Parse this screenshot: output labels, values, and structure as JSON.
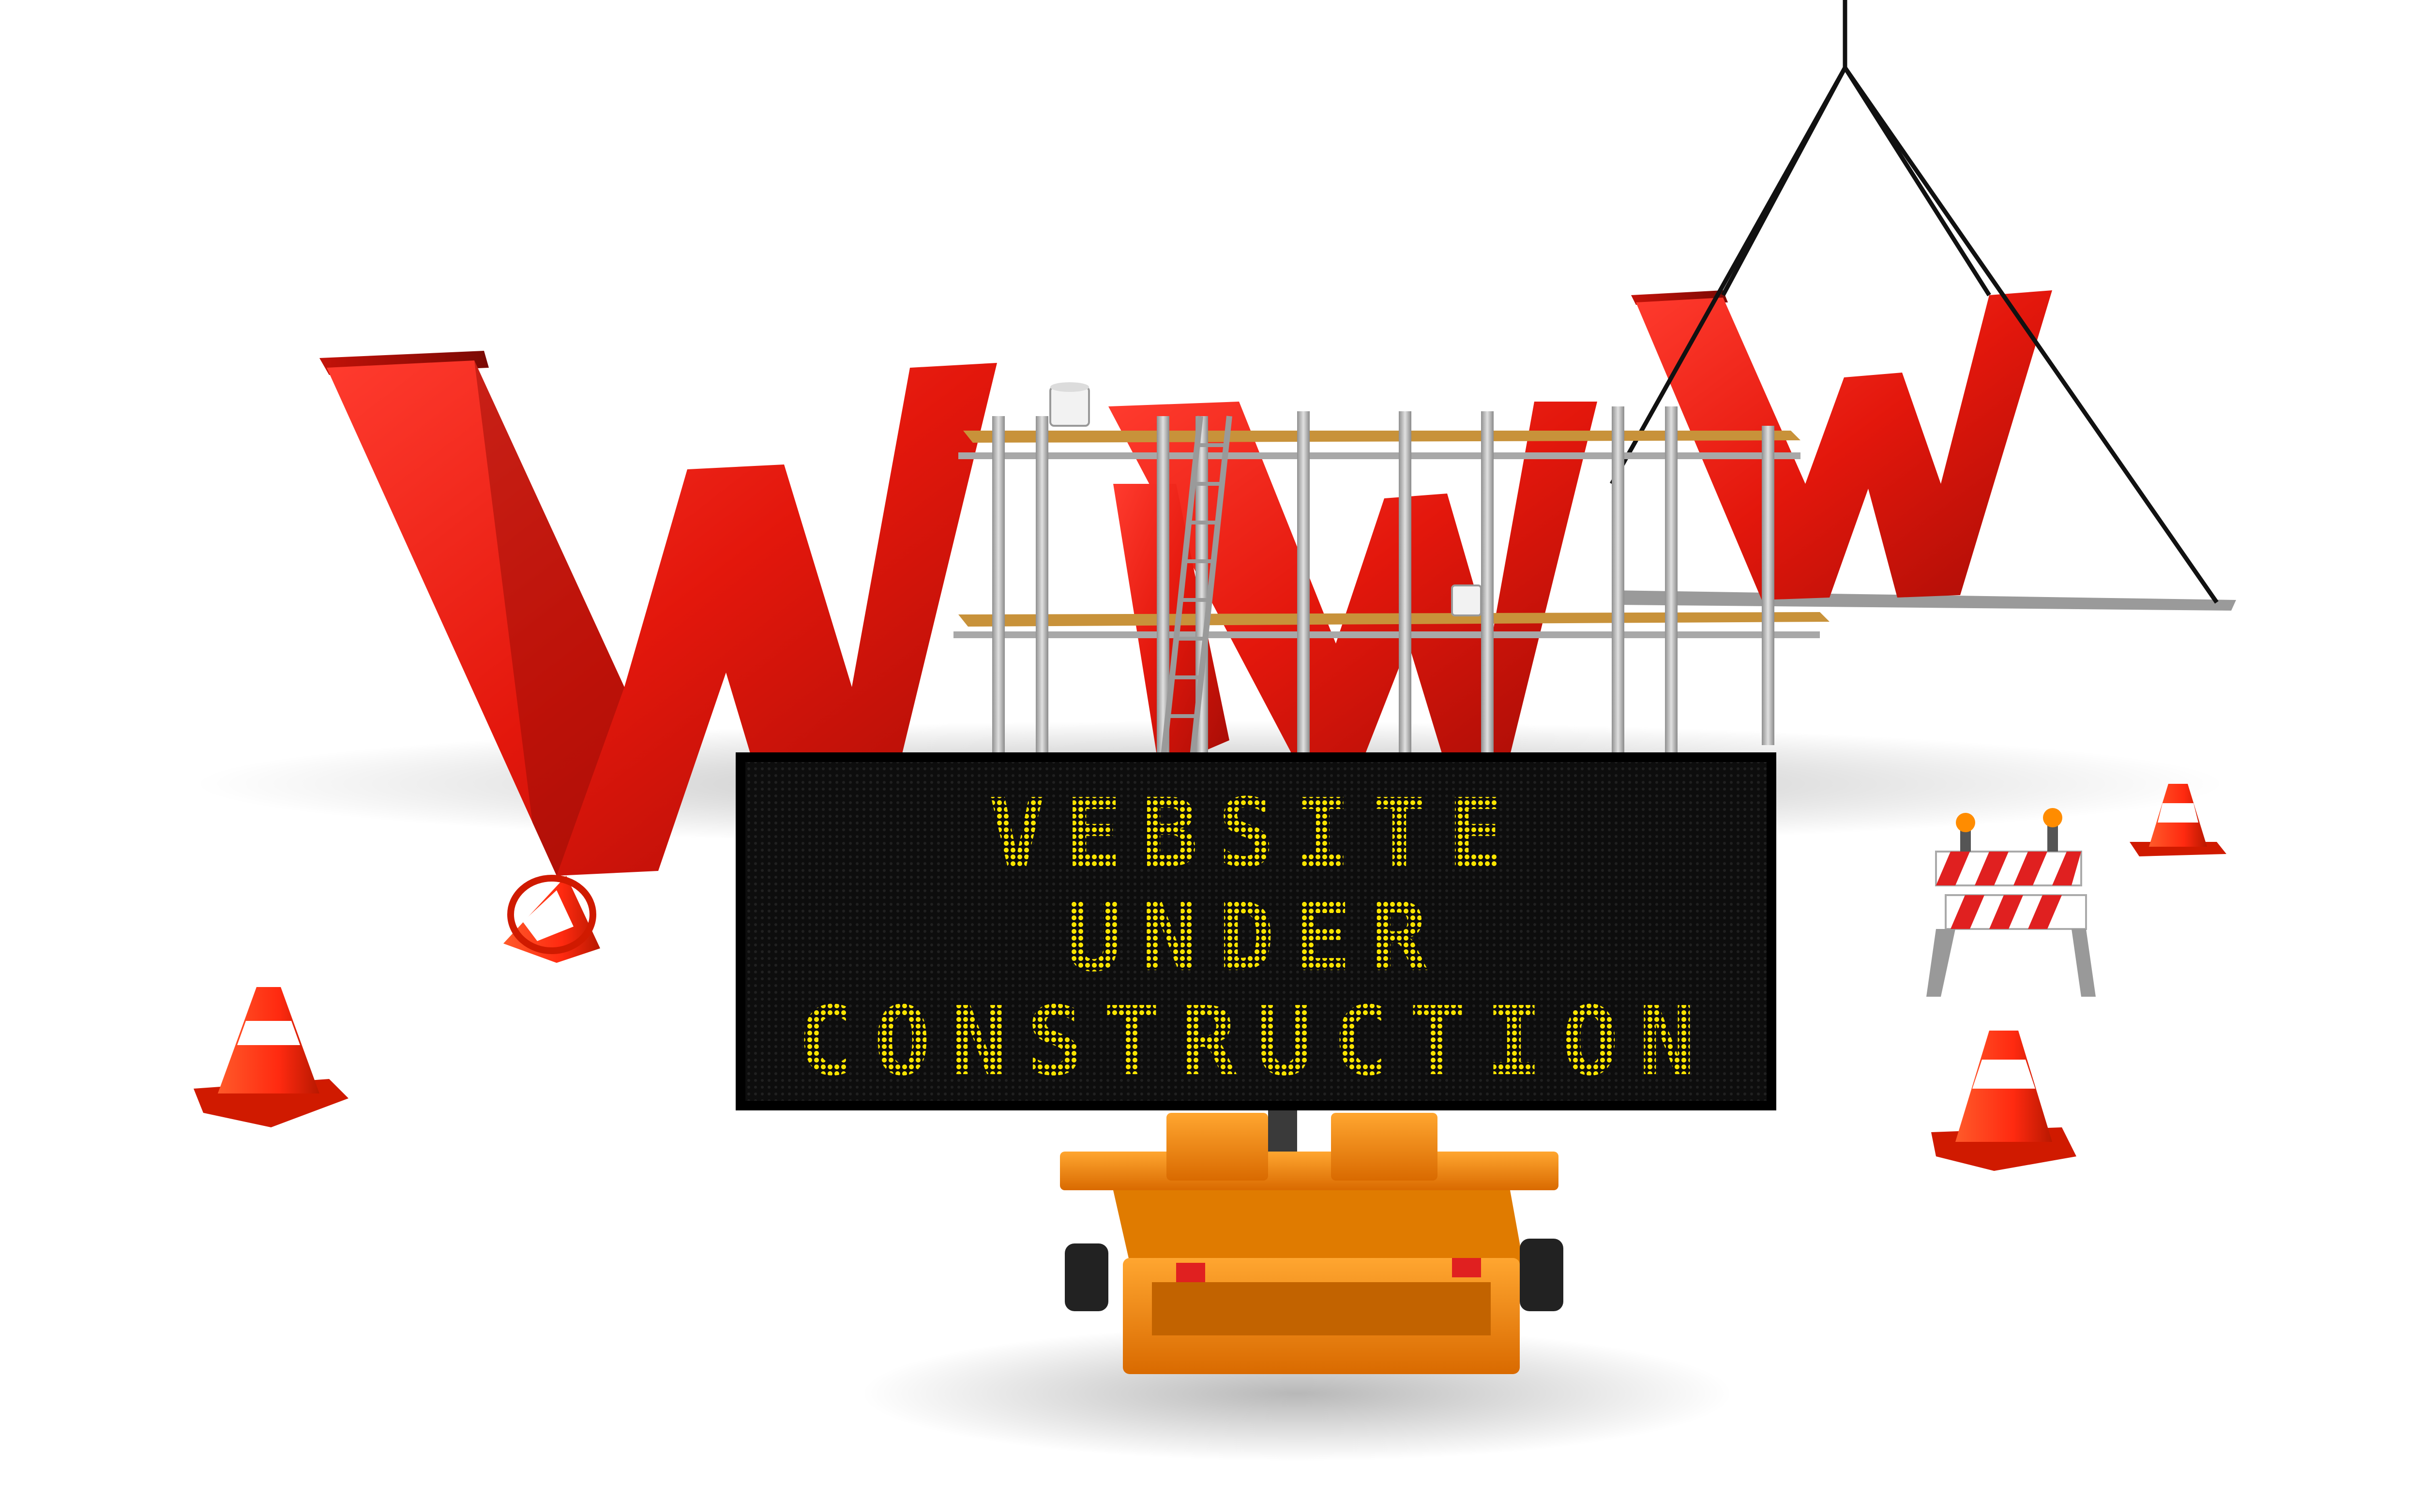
{
  "sign": {
    "lines": [
      "VEBSITE",
      "UNDER",
      "CONSTRUCTION"
    ],
    "text_color": "#ffe600",
    "panel_color": "#111111"
  },
  "letters": {
    "text": "W",
    "count": 3,
    "color": "#e8190f"
  },
  "colors": {
    "cone": "#ff3a14",
    "cone_stripe": "#ffffff",
    "trailer": "#ff8c00",
    "scaffold_pole": "#b8b8b8",
    "plank": "#c8923a",
    "rope": "#111111"
  },
  "icons": [
    "traffic-cone-icon",
    "barricade-icon",
    "ladder-icon",
    "paint-bucket-icon",
    "trailer-icon",
    "crane-rope-icon"
  ]
}
